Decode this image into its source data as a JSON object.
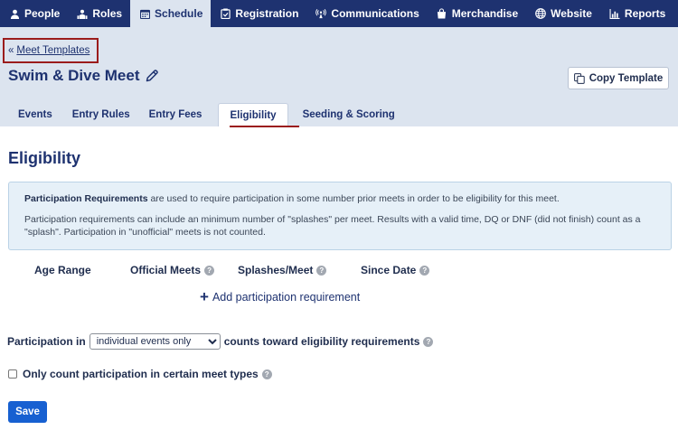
{
  "nav": {
    "items": [
      {
        "label": "People",
        "icon": "person-icon"
      },
      {
        "label": "Roles",
        "icon": "roles-icon"
      },
      {
        "label": "Schedule",
        "icon": "calendar-icon",
        "active": true
      },
      {
        "label": "Registration",
        "icon": "clipboard-check-icon"
      },
      {
        "label": "Communications",
        "icon": "broadcast-icon"
      },
      {
        "label": "Merchandise",
        "icon": "shopping-bag-icon"
      },
      {
        "label": "Website",
        "icon": "globe-icon"
      },
      {
        "label": "Reports",
        "icon": "bar-chart-icon"
      }
    ]
  },
  "header": {
    "back_arrow": "«",
    "back_link": "Meet Templates",
    "title": "Swim & Dive Meet",
    "copy_button": "Copy Template"
  },
  "tabs": [
    {
      "label": "Events"
    },
    {
      "label": "Entry Rules"
    },
    {
      "label": "Entry Fees"
    },
    {
      "label": "Eligibility",
      "active": true
    },
    {
      "label": "Seeding & Scoring"
    }
  ],
  "main": {
    "section_title": "Eligibility",
    "info": {
      "bold_lead": "Participation Requirements",
      "line1_rest": " are used to require participation in some number prior meets in order to be eligibility for this meet.",
      "line2": "Participation requirements can include an minimum number of \"splashes\" per meet. Results with a valid time, DQ or DNF (did not finish) count as a \"splash\". Participation in \"unofficial\" meets is not counted."
    },
    "columns": {
      "age_range": "Age Range",
      "official_meets": "Official Meets",
      "splashes_per_meet": "Splashes/Meet",
      "since_date": "Since Date"
    },
    "help_glyph": "?",
    "add_requirement": "Add participation requirement",
    "add_plus": "+",
    "participation": {
      "prefix": "Participation in",
      "selected": "individual events only",
      "suffix": "counts toward eligibility requirements"
    },
    "checkbox_label": "Only count participation in certain meet types",
    "save_button": "Save"
  },
  "colors": {
    "nav_bg": "#1e3270",
    "header_bg": "#dce4ef",
    "accent_red": "#9b1c1c",
    "save_blue": "#1760d1",
    "info_bg": "#e6f0f8"
  }
}
